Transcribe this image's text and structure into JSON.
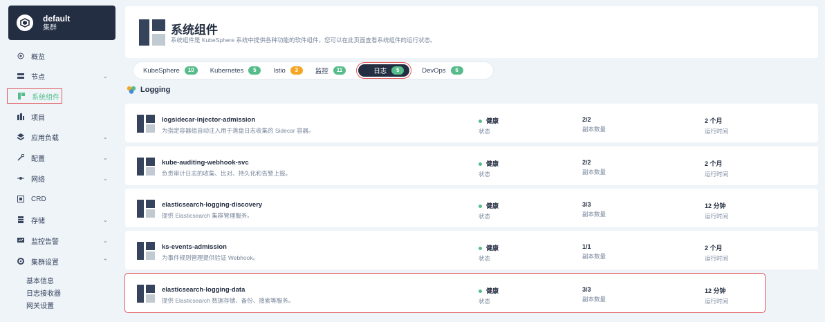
{
  "cluster": {
    "name": "default",
    "sub": "集群"
  },
  "nav": {
    "items": [
      {
        "label": "概览",
        "icon": "dashboard-icon",
        "chevron": false
      },
      {
        "label": "节点",
        "icon": "server-icon",
        "chevron": true
      },
      {
        "label": "系统组件",
        "icon": "components-icon",
        "chevron": false,
        "active": true
      },
      {
        "label": "项目",
        "icon": "project-icon",
        "chevron": false
      },
      {
        "label": "应用负载",
        "icon": "workload-icon",
        "chevron": true
      },
      {
        "label": "配置",
        "icon": "wrench-icon",
        "chevron": true
      },
      {
        "label": "网络",
        "icon": "network-icon",
        "chevron": true
      },
      {
        "label": "CRD",
        "icon": "crd-icon",
        "chevron": false
      },
      {
        "label": "存储",
        "icon": "storage-icon",
        "chevron": true
      },
      {
        "label": "监控告警",
        "icon": "monitor-icon",
        "chevron": true
      },
      {
        "label": "集群设置",
        "icon": "settings-icon",
        "chevron": "up"
      }
    ],
    "sub_items": [
      "基本信息",
      "日志接收器",
      "网关设置"
    ]
  },
  "header": {
    "title": "系统组件",
    "description": "系统组件是 KubeSphere 系统中提供各种功能的软件组件，您可以在此页面查看系统组件的运行状态。"
  },
  "tabs": [
    {
      "label": "KubeSphere",
      "count": "10",
      "color": "#55bc8a"
    },
    {
      "label": "Kubernetes",
      "count": "5",
      "color": "#55bc8a"
    },
    {
      "label": "Istio",
      "count": "3",
      "color": "#f5a623"
    },
    {
      "label": "监控",
      "count": "11",
      "color": "#55bc8a"
    },
    {
      "label": "日志",
      "count": "5",
      "color": "#55bc8a",
      "active": true
    },
    {
      "label": "DevOps",
      "count": "6",
      "color": "#55bc8a"
    }
  ],
  "section": {
    "title": "Logging"
  },
  "components": [
    {
      "name": "logsidecar-injector-admission",
      "desc": "为指定容器组自动注入用于落盘日志收集的 Sidecar 容器。",
      "status": "健康",
      "status_label": "状态",
      "replicas": "2/2",
      "replicas_label": "副本数量",
      "age": "2 个月",
      "age_label": "运行时间"
    },
    {
      "name": "kube-auditing-webhook-svc",
      "desc": "负责审计日志的收集、比对、持久化和告警上报。",
      "status": "健康",
      "status_label": "状态",
      "replicas": "2/2",
      "replicas_label": "副本数量",
      "age": "2 个月",
      "age_label": "运行时间"
    },
    {
      "name": "elasticsearch-logging-discovery",
      "desc": "提供 Elasticsearch 集群管理服务。",
      "status": "健康",
      "status_label": "状态",
      "replicas": "3/3",
      "replicas_label": "副本数量",
      "age": "12 分钟",
      "age_label": "运行时间"
    },
    {
      "name": "ks-events-admission",
      "desc": "为事件规则管理提供验证 Webhook。",
      "status": "健康",
      "status_label": "状态",
      "replicas": "1/1",
      "replicas_label": "副本数量",
      "age": "2 个月",
      "age_label": "运行时间"
    },
    {
      "name": "elasticsearch-logging-data",
      "desc": "提供 Elasticsearch 数据存储、备份、搜索等服务。",
      "status": "健康",
      "status_label": "状态",
      "replicas": "3/3",
      "replicas_label": "副本数量",
      "age": "12 分钟",
      "age_label": "运行时间",
      "highlight": true
    }
  ],
  "colors": {
    "accent": "#55bc8a",
    "dark": "#242e42",
    "warning": "#f5a623",
    "highlight_border": "#e0585a"
  }
}
